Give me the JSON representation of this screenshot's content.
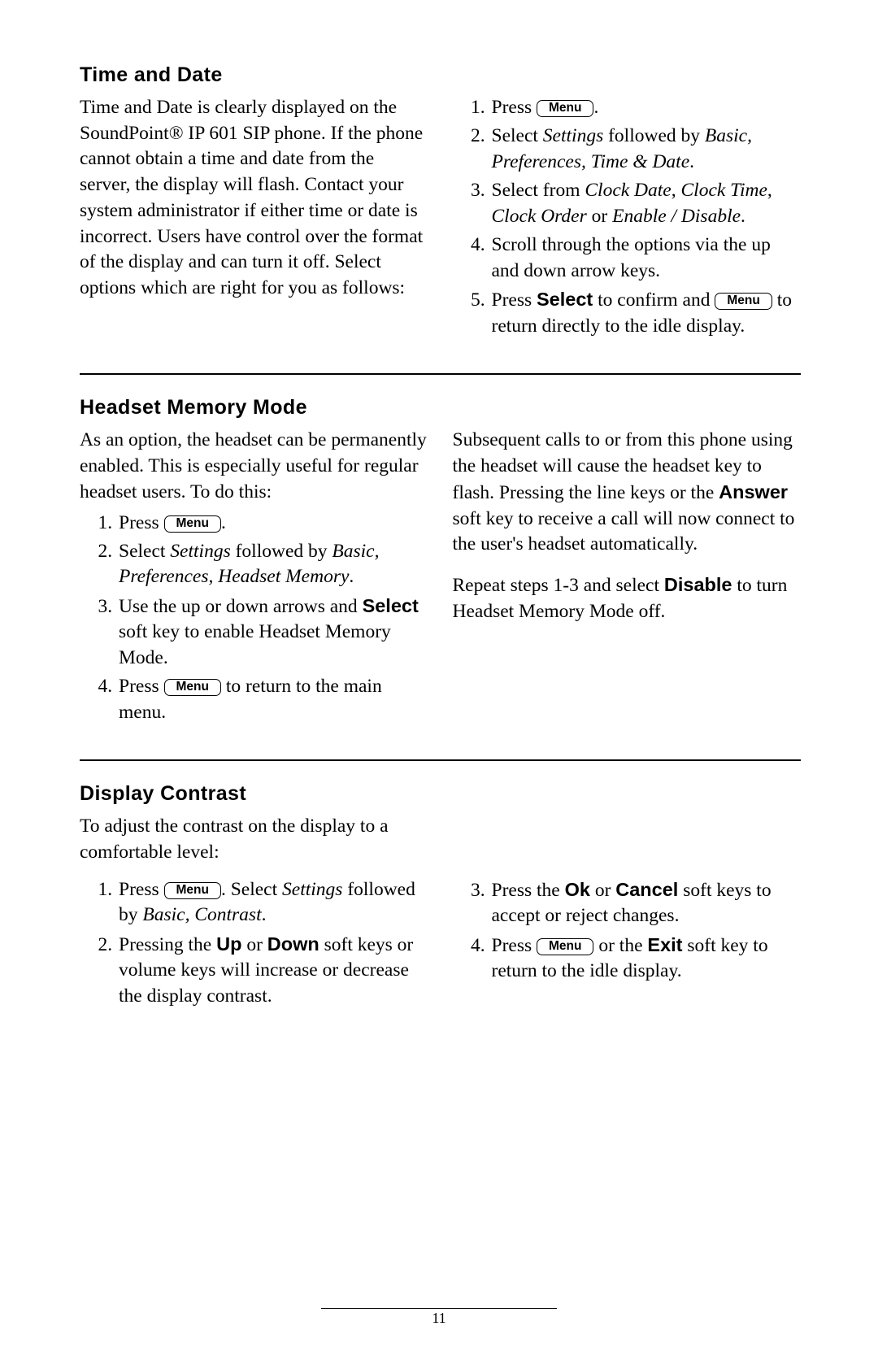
{
  "menu_label": "Menu",
  "page_number": "11",
  "sections": {
    "time_date": {
      "title": "Time and Date",
      "intro": "Time and Date is clearly displayed on the SoundPoint® IP 601 SIP phone.  If the phone cannot obtain a time and date from the server, the display will flash.  Contact your system administrator if either time or date is incorrect.  Users have control over the format of the display and can turn it off.  Select options which are right for you as follows:",
      "steps": {
        "s1_a": "Press ",
        "s1_b": ".",
        "s2_a": "Select ",
        "s2_i1": "Settings",
        "s2_b": " followed by ",
        "s2_i2": "Basic, Preferences, Time & Date",
        "s2_c": ".",
        "s3_a": "Select from ",
        "s3_i1": "Clock Date",
        "s3_b": ", ",
        "s3_i2": "Clock Time",
        "s3_c": ", ",
        "s3_i3": "Clock Order",
        "s3_d": " or ",
        "s3_i4": "Enable / Disable",
        "s3_e": ".",
        "s4": "Scroll through the options via the up and down arrow keys.",
        "s5_a": "Press ",
        "s5_bold": "Select",
        "s5_b": " to confirm and ",
        "s5_c": " to return directly to the idle display."
      }
    },
    "headset": {
      "title": "Headset Memory Mode",
      "intro": "As an option, the headset can be perma­nently enabled.  This is especially useful for regular headset users.  To do this:",
      "steps": {
        "s1_a": "Press ",
        "s1_b": ".",
        "s2_a": "Select ",
        "s2_i1": "Settings",
        "s2_b": " followed by ",
        "s2_i2": "Basic, Preferences, Headset Memory",
        "s2_c": ".",
        "s3_a": "Use the up or down arrows and ",
        "s3_bold": "Select",
        "s3_b": " soft key to enable Headset Memory Mode.",
        "s4_a": "Press ",
        "s4_b": " to return to the main menu."
      },
      "right_p1_a": "Subsequent calls to or from this phone using the headset will cause the headset key to flash.  Pressing the line keys or the ",
      "right_p1_bold": "Answer",
      "right_p1_b": " soft key to receive a call will now connect to the user's headset automati­cally.",
      "right_p2_a": "Repeat steps 1-3 and select ",
      "right_p2_bold": "Disable",
      "right_p2_b": " to turn Headset Memory Mode off."
    },
    "contrast": {
      "title": "Display Contrast",
      "intro": "To adjust the contrast on the display to a comfortable level:",
      "left": {
        "s1_a": "Press ",
        "s1_b": ".  Select ",
        "s1_i1": "Settings",
        "s1_c": " fol­lowed by ",
        "s1_i2": "Basic, Contrast",
        "s1_d": ".",
        "s2_a": "Pressing the ",
        "s2_bold1": "Up",
        "s2_b": " or ",
        "s2_bold2": "Down",
        "s2_c": " soft keys or volume keys will increase or decrease the display contrast."
      },
      "right": {
        "s3_a": "Press the ",
        "s3_bold1": "Ok",
        "s3_b": " or ",
        "s3_bold2": "Cancel",
        "s3_c": " soft keys to accept or reject changes.",
        "s4_a": "Press ",
        "s4_b": " or the ",
        "s4_bold": "Exit",
        "s4_c": " soft key to return to the idle display."
      }
    }
  }
}
